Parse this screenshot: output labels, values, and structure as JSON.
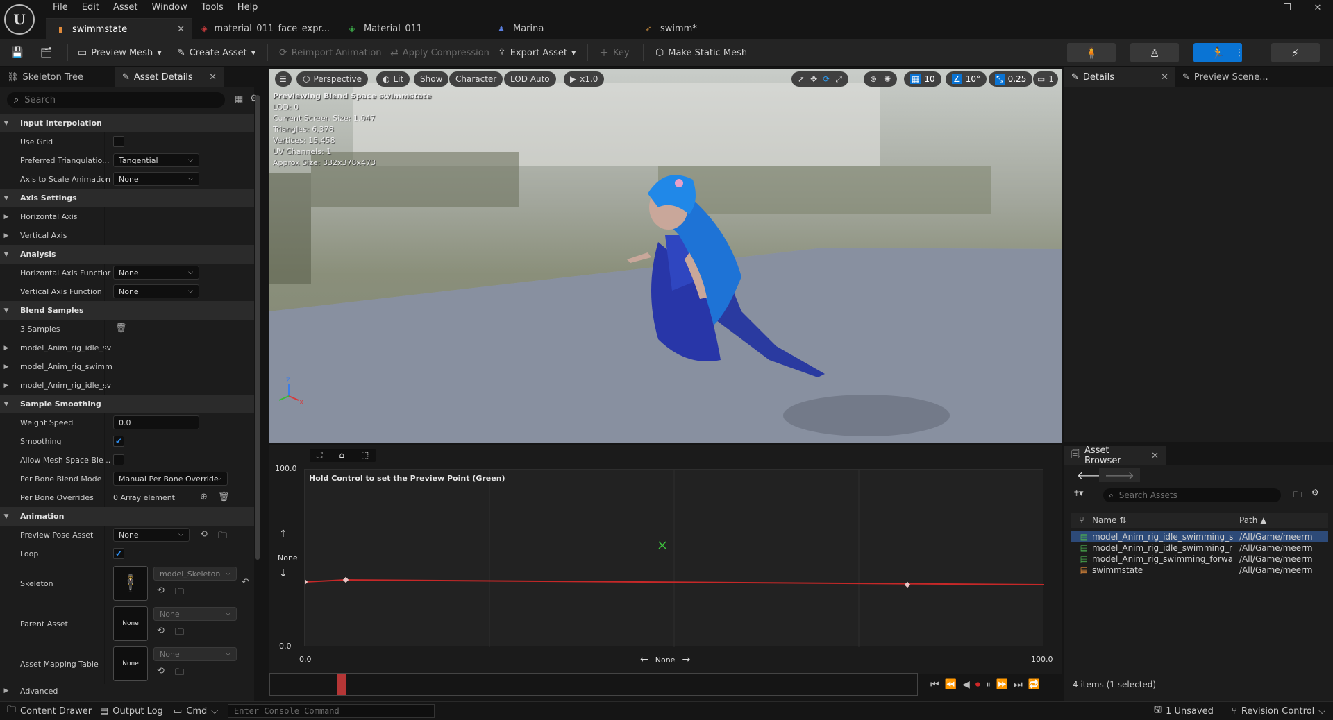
{
  "app": {
    "logo_text": "U",
    "menu": [
      "File",
      "Edit",
      "Asset",
      "Window",
      "Tools",
      "Help"
    ],
    "window_controls": [
      "–",
      "❐",
      "✕"
    ]
  },
  "tabs": [
    {
      "label": "swimmstate",
      "icon": "blendspace-icon",
      "active": true
    },
    {
      "label": "material_011_face_expr...",
      "icon": "material-icon",
      "active": false
    },
    {
      "label": "Material_011",
      "icon": "material-instance-icon",
      "active": false
    },
    {
      "label": "Marina",
      "icon": "skeletal-mesh-icon",
      "active": false
    },
    {
      "label": "swimm*",
      "icon": "animation-icon",
      "active": false
    }
  ],
  "toolbar": {
    "preview_mesh": "Preview Mesh",
    "create_asset": "Create Asset",
    "reimport_animation": "Reimport Animation",
    "apply_compression": "Apply Compression",
    "export_asset": "Export Asset",
    "key": "Key",
    "make_static_mesh": "Make Static Mesh"
  },
  "left_panel": {
    "tabs": [
      "Skeleton Tree",
      "Asset Details"
    ],
    "search_placeholder": "Search",
    "rows": {
      "input_interpolation": "Input Interpolation",
      "use_grid": "Use Grid",
      "preferred_triangulation": "Preferred Triangulatio...",
      "preferred_triangulation_value": "Tangential",
      "axis_to_scale": "Axis to Scale Animation",
      "axis_to_scale_value": "None",
      "axis_settings": "Axis Settings",
      "horizontal_axis": "Horizontal Axis",
      "vertical_axis": "Vertical Axis",
      "analysis": "Analysis",
      "h_axis_function": "Horizontal Axis Functior",
      "h_axis_function_value": "None",
      "v_axis_function": "Vertical Axis Function",
      "v_axis_function_value": "None",
      "blend_samples": "Blend Samples",
      "samples_count": "3 Samples",
      "sample_1": "model_Anim_rig_idle_sv",
      "sample_2": "model_Anim_rig_swimm",
      "sample_3": "model_Anim_rig_idle_sv",
      "sample_smoothing": "Sample Smoothing",
      "weight_speed": "Weight Speed",
      "weight_speed_value": "0.0",
      "smoothing": "Smoothing",
      "allow_mesh_space": "Allow Mesh Space Ble...",
      "per_bone_blend_mode": "Per Bone Blend Mode",
      "per_bone_blend_mode_value": "Manual Per Bone Override",
      "per_bone_overrides": "Per Bone Overrides",
      "per_bone_overrides_value": "0 Array element",
      "animation": "Animation",
      "preview_pose_asset": "Preview Pose Asset",
      "preview_pose_asset_value": "None",
      "loop": "Loop",
      "skeleton": "Skeleton",
      "skeleton_value": "model_Skeleton",
      "parent_asset": "Parent Asset",
      "parent_asset_value": "None",
      "parent_thumb": "None",
      "asset_mapping_table": "Asset Mapping Table",
      "asset_mapping_value": "None",
      "asset_mapping_thumb": "None",
      "advanced": "Advanced"
    },
    "checks": {
      "use_grid": false,
      "smoothing": true,
      "allow_mesh_space": false,
      "loop": true
    }
  },
  "viewport": {
    "menu_icon": "☰",
    "perspective": "Perspective",
    "lit": "Lit",
    "show": "Show",
    "character": "Character",
    "lod": "LOD Auto",
    "speed": "x1.0",
    "grid_snap": "10",
    "rot_snap": "10°",
    "scale_snap": "0.25",
    "camera_speed": "1",
    "stats": [
      "Previewing Blend Space swimmstate",
      "LOD: 0",
      "Current Screen Size: 1.047",
      "Triangles: 6,378",
      "Vertices: 15,458",
      "UV Channels: 1",
      "Approx Size: 332x378x473"
    ]
  },
  "blend_graph": {
    "hint": "Hold Control to set the Preview Point (Green)",
    "y_max": "100.0",
    "y_min": "0.0",
    "x_min": "0.0",
    "x_max": "100.0",
    "v_axis_label": "None",
    "h_axis_label": "None"
  },
  "details_panel": {
    "tabs": [
      "Details",
      "Preview Scene..."
    ]
  },
  "asset_browser": {
    "title": "Asset Browser",
    "search_placeholder": "Search Assets",
    "col_name": "Name",
    "col_path": "Path",
    "items": [
      {
        "name": "model_Anim_rig_idle_swimming_s",
        "path": "/All/Game/meerm",
        "selected": true,
        "type": "anim"
      },
      {
        "name": "model_Anim_rig_idle_swimming_r",
        "path": "/All/Game/meerm",
        "selected": false,
        "type": "anim"
      },
      {
        "name": "model_Anim_rig_swimming_forwa",
        "path": "/All/Game/meerm",
        "selected": false,
        "type": "anim"
      },
      {
        "name": "swimmstate",
        "path": "/All/Game/meerm",
        "selected": false,
        "type": "blendspace"
      }
    ],
    "count": "4 items (1 selected)"
  },
  "statusbar": {
    "content_drawer": "Content Drawer",
    "output_log": "Output Log",
    "cmd": "Cmd",
    "console_placeholder": "Enter Console Command",
    "unsaved": "1 Unsaved",
    "revision_control": "Revision Control"
  },
  "colors": {
    "accent": "#0a74d4",
    "graph_line": "#c62828",
    "preview_point": "#3ec43e"
  }
}
